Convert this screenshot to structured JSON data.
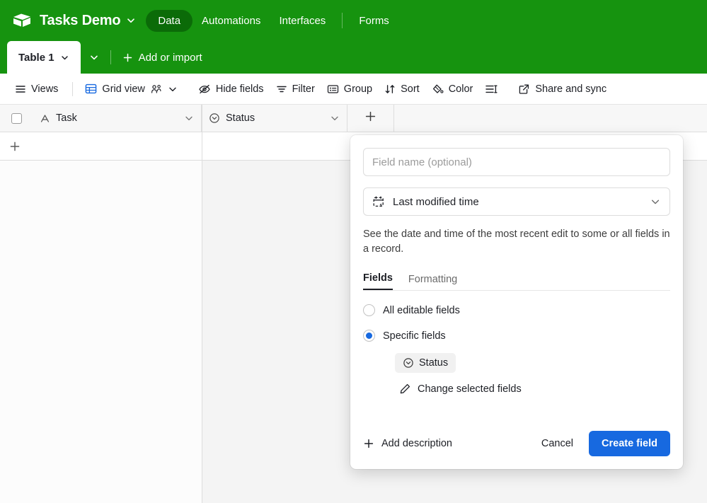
{
  "header": {
    "logo_icon": "airtable-cube-logo",
    "app_title": "Tasks Demo",
    "title_caret_icon": "chevron-down-icon",
    "nav": [
      {
        "label": "Data",
        "active": true
      },
      {
        "label": "Automations",
        "active": false
      },
      {
        "label": "Interfaces",
        "active": false
      },
      {
        "label": "Forms",
        "active": false
      }
    ],
    "brand_color": "#16930f",
    "active_pill_color": "#0b6b08"
  },
  "tabstrip": {
    "active_tab": "Table 1",
    "tab_caret_icon": "chevron-down-icon",
    "more_tabs_icon": "chevron-down-icon",
    "add_label": "Add or import",
    "add_icon": "plus-icon"
  },
  "toolbar": {
    "views_label": "Views",
    "views_icon": "hamburger-icon",
    "grid_view_label": "Grid view",
    "grid_view_icon": "grid-icon",
    "collaborators_icon": "collaborators-icon",
    "grid_view_caret_icon": "chevron-down-icon",
    "hide_fields_label": "Hide fields",
    "hide_fields_icon": "eye-slash-icon",
    "filter_label": "Filter",
    "filter_icon": "filter-icon",
    "group_label": "Group",
    "group_icon": "group-icon",
    "sort_label": "Sort",
    "sort_icon": "sort-arrows-icon",
    "color_label": "Color",
    "color_icon": "paint-bucket-icon",
    "row_height_icon": "row-height-icon",
    "share_label": "Share and sync",
    "share_icon": "external-link-icon"
  },
  "grid": {
    "select_all_icon": "checkbox-icon",
    "columns": [
      {
        "label": "Task",
        "type_icon": "text-field-icon",
        "caret_icon": "chevron-down-icon"
      },
      {
        "label": "Status",
        "type_icon": "single-select-icon",
        "caret_icon": "chevron-down-icon"
      }
    ],
    "add_column_icon": "plus-icon",
    "add_row_icon": "plus-icon",
    "rows": []
  },
  "field_popup": {
    "name_placeholder": "Field name (optional)",
    "name_value": "",
    "type_value": "Last modified time",
    "type_icon": "calendar-bolt-icon",
    "type_caret_icon": "chevron-down-icon",
    "description": "See the date and time of the most recent edit to some or all fields in a record.",
    "tabs": [
      {
        "label": "Fields",
        "active": true
      },
      {
        "label": "Formatting",
        "active": false
      }
    ],
    "options": [
      {
        "label": "All editable fields",
        "selected": false
      },
      {
        "label": "Specific fields",
        "selected": true
      }
    ],
    "selected_fields": [
      {
        "label": "Status",
        "icon": "single-select-icon"
      }
    ],
    "change_fields_label": "Change selected fields",
    "change_fields_icon": "pencil-icon",
    "add_description_label": "Add description",
    "add_description_icon": "plus-icon",
    "cancel_label": "Cancel",
    "create_label": "Create field",
    "accent_color": "#1769e0"
  }
}
